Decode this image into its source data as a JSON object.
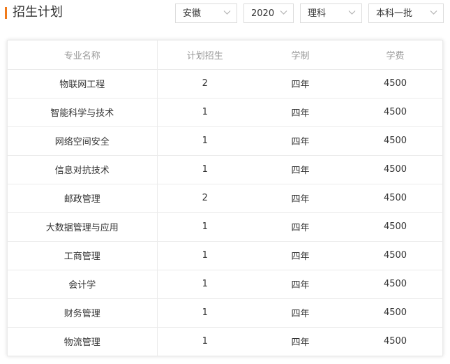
{
  "header": {
    "title": "招生计划",
    "accent_color": "#f07a1a"
  },
  "filters": {
    "province": {
      "value": "安徽",
      "icon": "chevron-down-icon"
    },
    "year": {
      "value": "2020",
      "icon": "chevron-down-icon"
    },
    "subject": {
      "value": "理科",
      "icon": "chevron-down-icon"
    },
    "batch": {
      "value": "本科一批",
      "icon": "chevron-down-icon"
    }
  },
  "table": {
    "columns": [
      "专业名称",
      "计划招生",
      "学制",
      "学费"
    ],
    "rows": [
      [
        "物联网工程",
        "2",
        "四年",
        "4500"
      ],
      [
        "智能科学与技术",
        "1",
        "四年",
        "4500"
      ],
      [
        "网络空间安全",
        "1",
        "四年",
        "4500"
      ],
      [
        "信息对抗技术",
        "1",
        "四年",
        "4500"
      ],
      [
        "邮政管理",
        "2",
        "四年",
        "4500"
      ],
      [
        "大数据管理与应用",
        "1",
        "四年",
        "4500"
      ],
      [
        "工商管理",
        "1",
        "四年",
        "4500"
      ],
      [
        "会计学",
        "1",
        "四年",
        "4500"
      ],
      [
        "财务管理",
        "1",
        "四年",
        "4500"
      ],
      [
        "物流管理",
        "1",
        "四年",
        "4500"
      ]
    ]
  }
}
